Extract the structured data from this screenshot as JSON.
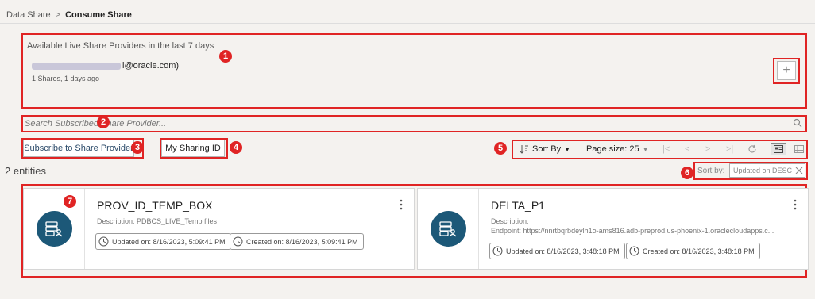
{
  "breadcrumb": {
    "root": "Data Share",
    "separator": ">",
    "current": "Consume Share"
  },
  "providers": {
    "heading": "Available Live Share Providers in the last 7 days",
    "email_suffix": "i@oracle.com)",
    "meta": "1 Shares, 1 days ago",
    "add_label": "+"
  },
  "search": {
    "placeholder": "Search Subscribed Share Provider..."
  },
  "buttons": {
    "subscribe": "Subscribe to Share Provider",
    "sharing_id": "My Sharing ID"
  },
  "toolbar": {
    "sort_by": "Sort By",
    "page_size": "Page size: 25",
    "nav": {
      "first": "|<",
      "prev": "<",
      "next": ">",
      "last": ">|"
    }
  },
  "entities": "2 entities",
  "sort": {
    "label": "Sort by:",
    "chip": "Updated on DESC"
  },
  "callouts": [
    "1",
    "2",
    "3",
    "4",
    "5",
    "6",
    "7"
  ],
  "cards": [
    {
      "title": "PROV_ID_TEMP_BOX",
      "description": "Description: PDBCS_LIVE_Temp files",
      "endpoint": "",
      "updated": "Updated on: 8/16/2023, 5:09:41 PM",
      "created": "Created on: 8/16/2023, 5:09:41 PM"
    },
    {
      "title": "DELTA_P1",
      "description": "Description:",
      "endpoint": "Endpoint: https://nnrtbqrbdeylh1o-ams816.adb-preprod.us-phoenix-1.oraclecloudapps.c...",
      "updated": "Updated on: 8/16/2023, 3:48:18 PM",
      "created": "Created on: 8/16/2023, 3:48:18 PM"
    }
  ],
  "colors": {
    "annotation_red": "#e02424",
    "card_icon_bg": "#1c5878",
    "link_blue": "#2b4a69"
  }
}
